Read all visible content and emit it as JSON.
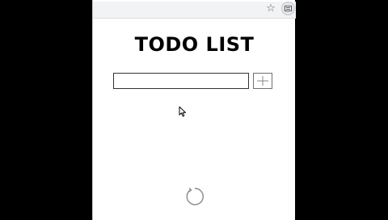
{
  "app": {
    "title": "TODO LIST"
  },
  "toolbar": {
    "icons": [
      "star-icon",
      "extension-icon"
    ]
  },
  "todo_input": {
    "value": "",
    "placeholder": ""
  },
  "add_button": {
    "icon": "plus-icon"
  },
  "footer": {
    "icon": "reload-icon"
  },
  "colors": {
    "background": "#000000",
    "popup_background": "#ffffff",
    "toolbar_background": "#f1f3f4",
    "text": "#000000",
    "input_border": "#333333",
    "button_border": "#6f6f6f",
    "icon_gray": "#8a8a8a"
  }
}
